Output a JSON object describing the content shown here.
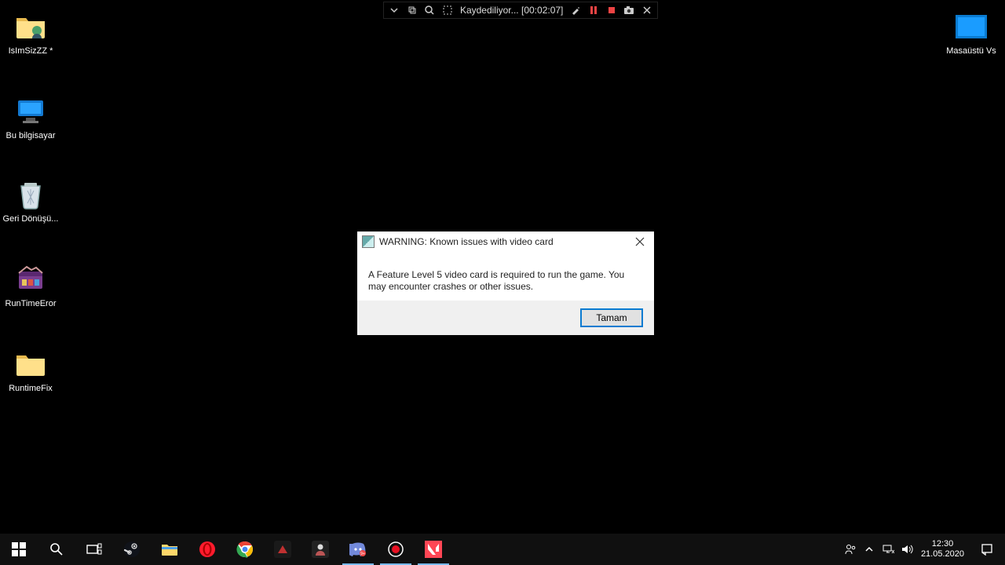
{
  "desktop_icons": {
    "i1": {
      "label": "IsImSizZZ *"
    },
    "i2": {
      "label": "Bu bilgisayar"
    },
    "i3": {
      "label": "Geri Dönüşü..."
    },
    "i4": {
      "label": "RunTimeEror"
    },
    "i5": {
      "label": "RuntimeFix"
    },
    "i6": {
      "label": "Masaüstü Vs"
    }
  },
  "recording": {
    "status_prefix": "Kaydediliyor...",
    "timecode": "[00:02:07]"
  },
  "dialog": {
    "title": "WARNING: Known issues with video card",
    "message": "A Feature Level 5 video card is required to run the game. You may encounter crashes or other issues.",
    "ok_label": "Tamam"
  },
  "tray": {
    "time": "12:30",
    "date": "21.05.2020"
  }
}
